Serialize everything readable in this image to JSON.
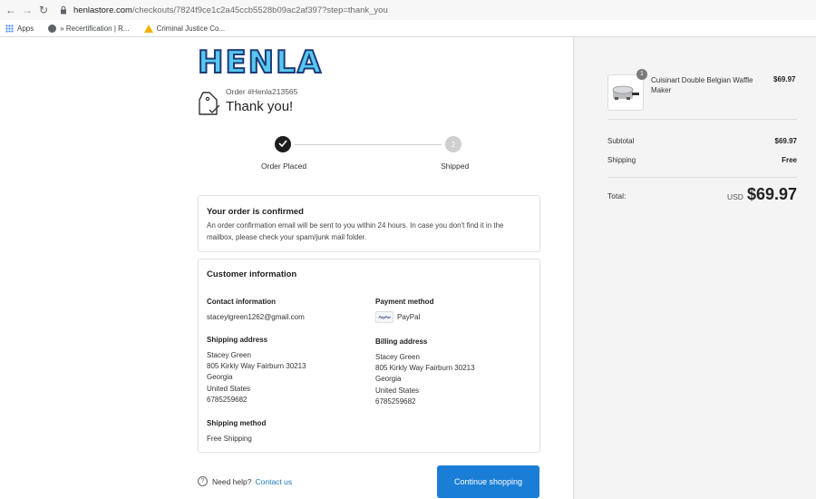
{
  "browser": {
    "url_host": "henlastore.com",
    "url_path": "/checkouts/7824f9ce1c2a45ccb5528b09ac2af397?step=thank_you",
    "bookmarks": [
      "Apps",
      "» Recertification | R...",
      "Criminal Justice Co..."
    ]
  },
  "brand": {
    "logo_text": "HENLA"
  },
  "order": {
    "number_label": "Order #Henla213565",
    "thank_you": "Thank you!"
  },
  "progress": {
    "steps": [
      {
        "label": "Order Placed",
        "status": "done"
      },
      {
        "label": "Shipped",
        "number": "2",
        "status": "pending"
      }
    ]
  },
  "confirmation": {
    "title": "Your order is confirmed",
    "message": "An order confirmation email will be sent to you within 24 hours. In case you don't find it in the mailbox, please check your spam/junk mail folder."
  },
  "customer": {
    "title": "Customer information",
    "contact_heading": "Contact information",
    "email": "staceylgreen1262@gmail.com",
    "payment_heading": "Payment method",
    "payment_logo": "PayPal",
    "payment_method": "PayPal",
    "shipping_heading": "Shipping address",
    "shipping_address": [
      "Stacey Green",
      "805 Kirkly Way Fairburn 30213",
      "Georgia",
      "United States",
      "6785259682"
    ],
    "billing_heading": "Billing address",
    "billing_address": [
      "Stacey Green",
      "805 Kirkly Way Fairburn 30213",
      "Georgia",
      "United States",
      "6785259682"
    ],
    "method_heading": "Shipping method",
    "shipping_method": "Free Shipping"
  },
  "footer": {
    "help_text": "Need help?",
    "contact_link": "Contact us",
    "continue_label": "Continue shopping"
  },
  "summary": {
    "item": {
      "quantity": "1",
      "name": "Cuisinart Double Belgian Waffle Maker",
      "price": "$69.97"
    },
    "subtotal_label": "Subtotal",
    "subtotal": "$69.97",
    "shipping_label": "Shipping",
    "shipping": "Free",
    "total_label": "Total:",
    "currency": "USD",
    "total": "$69.97"
  },
  "colors": {
    "accent": "#1b7ed6",
    "link": "#1878b9",
    "logo_fill": "#57c8f0",
    "logo_stroke": "#1e3c78"
  },
  "icons": [
    "back-arrow-icon",
    "forward-arrow-icon",
    "reload-icon",
    "lock-icon",
    "apps-grid-icon",
    "tag-check-icon",
    "checkmark-icon",
    "help-circle-icon",
    "paypal-logo-icon"
  ]
}
